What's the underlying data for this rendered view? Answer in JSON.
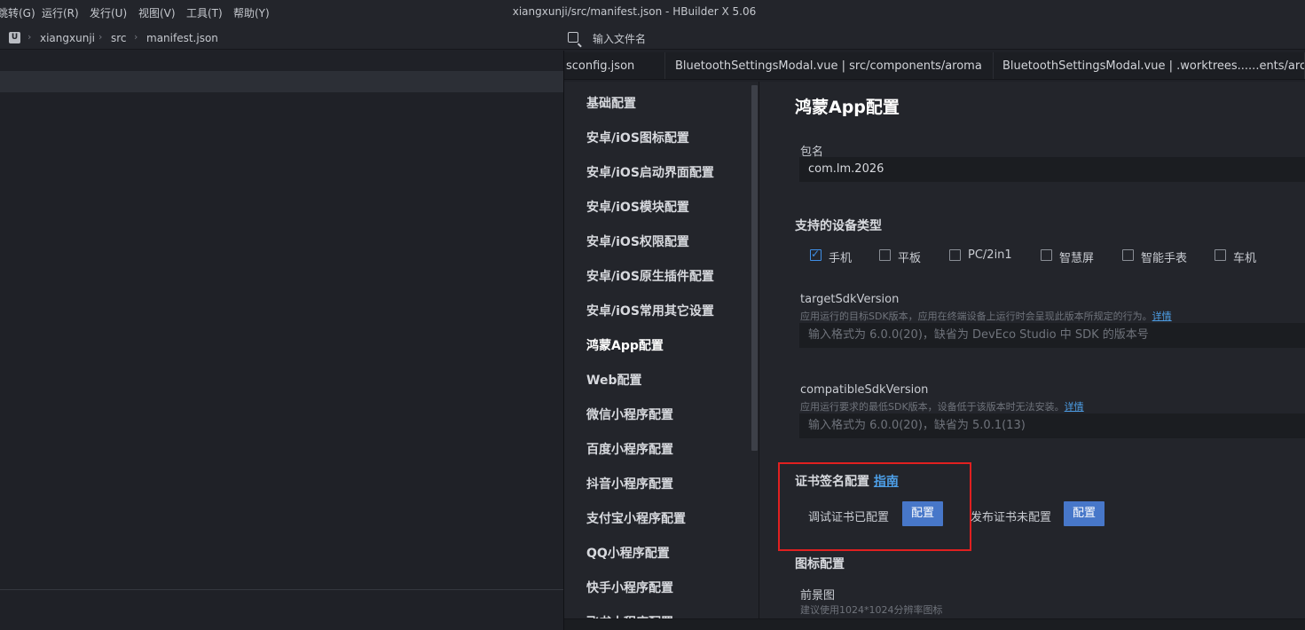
{
  "menubar": {
    "items": [
      "跳转(G)",
      "运行(R)",
      "发行(U)",
      "视图(V)",
      "工具(T)",
      "帮助(Y)"
    ],
    "title": "xiangxunji/src/manifest.json - HBuilder X 5.06"
  },
  "breadcrumb": {
    "logo": "U",
    "items": [
      "xiangxunji",
      "src",
      "manifest.json"
    ]
  },
  "findbar": {
    "placeholder": "输入文件名"
  },
  "tabs": [
    "sconfig.json",
    "BluetoothSettingsModal.vue | src/components/aroma",
    "BluetoothSettingsModal.vue | .worktrees......ents/aroma"
  ],
  "nav": {
    "items": [
      "基础配置",
      "安卓/iOS图标配置",
      "安卓/iOS启动界面配置",
      "安卓/iOS模块配置",
      "安卓/iOS权限配置",
      "安卓/iOS原生插件配置",
      "安卓/iOS常用其它设置",
      "鸿蒙App配置",
      "Web配置",
      "微信小程序配置",
      "百度小程序配置",
      "抖音小程序配置",
      "支付宝小程序配置",
      "QQ小程序配置",
      "快手小程序配置",
      "飞书小程序配置"
    ],
    "active_index": 7
  },
  "main": {
    "title": "鸿蒙App配置",
    "package": {
      "label": "包名",
      "value": "com.lm.2026"
    },
    "devices": {
      "title": "支持的设备类型",
      "options": [
        {
          "label": "手机",
          "checked": true
        },
        {
          "label": "平板",
          "checked": false
        },
        {
          "label": "PC/2in1",
          "checked": false
        },
        {
          "label": "智慧屏",
          "checked": false
        },
        {
          "label": "智能手表",
          "checked": false
        },
        {
          "label": "车机",
          "checked": false
        }
      ]
    },
    "targetSdk": {
      "label": "targetSdkVersion",
      "hint": "应用运行的目标SDK版本，应用在终端设备上运行时会呈现此版本所规定的行为。",
      "link": "详情",
      "placeholder": "输入格式为 6.0.0(20)，缺省为 DevEco Studio 中 SDK 的版本号"
    },
    "compatibleSdk": {
      "label": "compatibleSdkVersion",
      "hint": "应用运行要求的最低SDK版本，设备低于该版本时无法安装。",
      "link": "详情",
      "placeholder": "输入格式为 6.0.0(20)，缺省为 5.0.1(13)"
    },
    "cert": {
      "title": "证书签名配置",
      "guide": "指南",
      "debug_text": "调试证书已配置",
      "debug_button": "配置",
      "release_text": "发布证书未配置",
      "release_button": "配置"
    },
    "icon": {
      "title": "图标配置",
      "foreground_label": "前景图",
      "foreground_hint": "建议使用1024*1024分辨率图标"
    }
  },
  "colors": {
    "accent": "#4777c9",
    "link": "#4d9ee6",
    "highlight_border": "#e02020"
  }
}
